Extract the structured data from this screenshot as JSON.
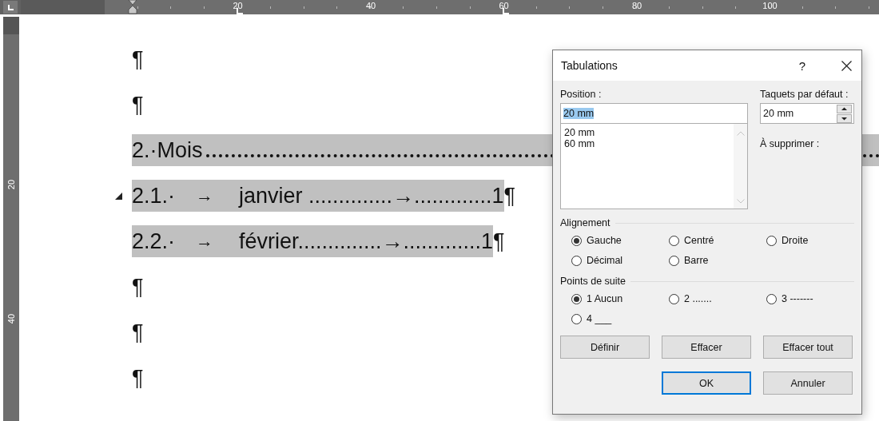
{
  "ruler": {
    "marks": [
      {
        "label": "20",
        "tab_stop": true
      },
      {
        "label": "40",
        "tab_stop": false
      },
      {
        "label": "60",
        "tab_stop": true
      },
      {
        "label": "80",
        "tab_stop": false
      },
      {
        "label": "100",
        "tab_stop": false
      }
    ],
    "vertical_marks": [
      {
        "label": "20"
      },
      {
        "label": "40"
      }
    ]
  },
  "document": {
    "paragraphs": [
      {
        "kind": "empty",
        "mark": "¶"
      },
      {
        "kind": "empty",
        "mark": "¶"
      },
      {
        "kind": "heading",
        "text": "2.·Mois",
        "highlighted": true
      },
      {
        "kind": "entry",
        "number": "2.1.·",
        "arrow": "→",
        "text": "janvier ..............→.............1",
        "mark": "¶",
        "highlighted": true,
        "collapsible": true
      },
      {
        "kind": "entry",
        "number": "2.2.·",
        "arrow": "→",
        "text": "février..............→.............1",
        "mark": "¶",
        "highlighted": true,
        "collapsible": false
      },
      {
        "kind": "empty",
        "mark": "¶"
      },
      {
        "kind": "empty",
        "mark": "¶"
      },
      {
        "kind": "empty",
        "mark": "¶"
      }
    ]
  },
  "dialog": {
    "title": "Tabulations",
    "help": "?",
    "position": {
      "label": "Position :",
      "value": "20 mm",
      "items": [
        {
          "text": "20 mm"
        },
        {
          "text": "60 mm"
        }
      ]
    },
    "default_stops": {
      "label": "Taquets par défaut :",
      "value": "20 mm"
    },
    "to_clear": {
      "label": "À supprimer :"
    },
    "alignment": {
      "label": "Alignement",
      "options": [
        {
          "label": "Gauche",
          "selected": true
        },
        {
          "label": "Centré",
          "selected": false
        },
        {
          "label": "Droite",
          "selected": false
        },
        {
          "label": "Décimal",
          "selected": false
        },
        {
          "label": "Barre",
          "selected": false
        }
      ]
    },
    "leader": {
      "label": "Points de suite",
      "options": [
        {
          "label": "1 Aucun",
          "selected": true
        },
        {
          "label": "2 .......",
          "selected": false
        },
        {
          "label": "3 -------",
          "selected": false
        },
        {
          "label": "4 ___",
          "selected": false
        }
      ]
    },
    "buttons": [
      {
        "label": "Définir",
        "default": false
      },
      {
        "label": "Effacer",
        "default": false
      },
      {
        "label": "Effacer tout",
        "default": false
      }
    ],
    "footer_buttons": [
      {
        "label": "OK",
        "default": true
      },
      {
        "label": "Annuler",
        "default": false
      }
    ]
  }
}
